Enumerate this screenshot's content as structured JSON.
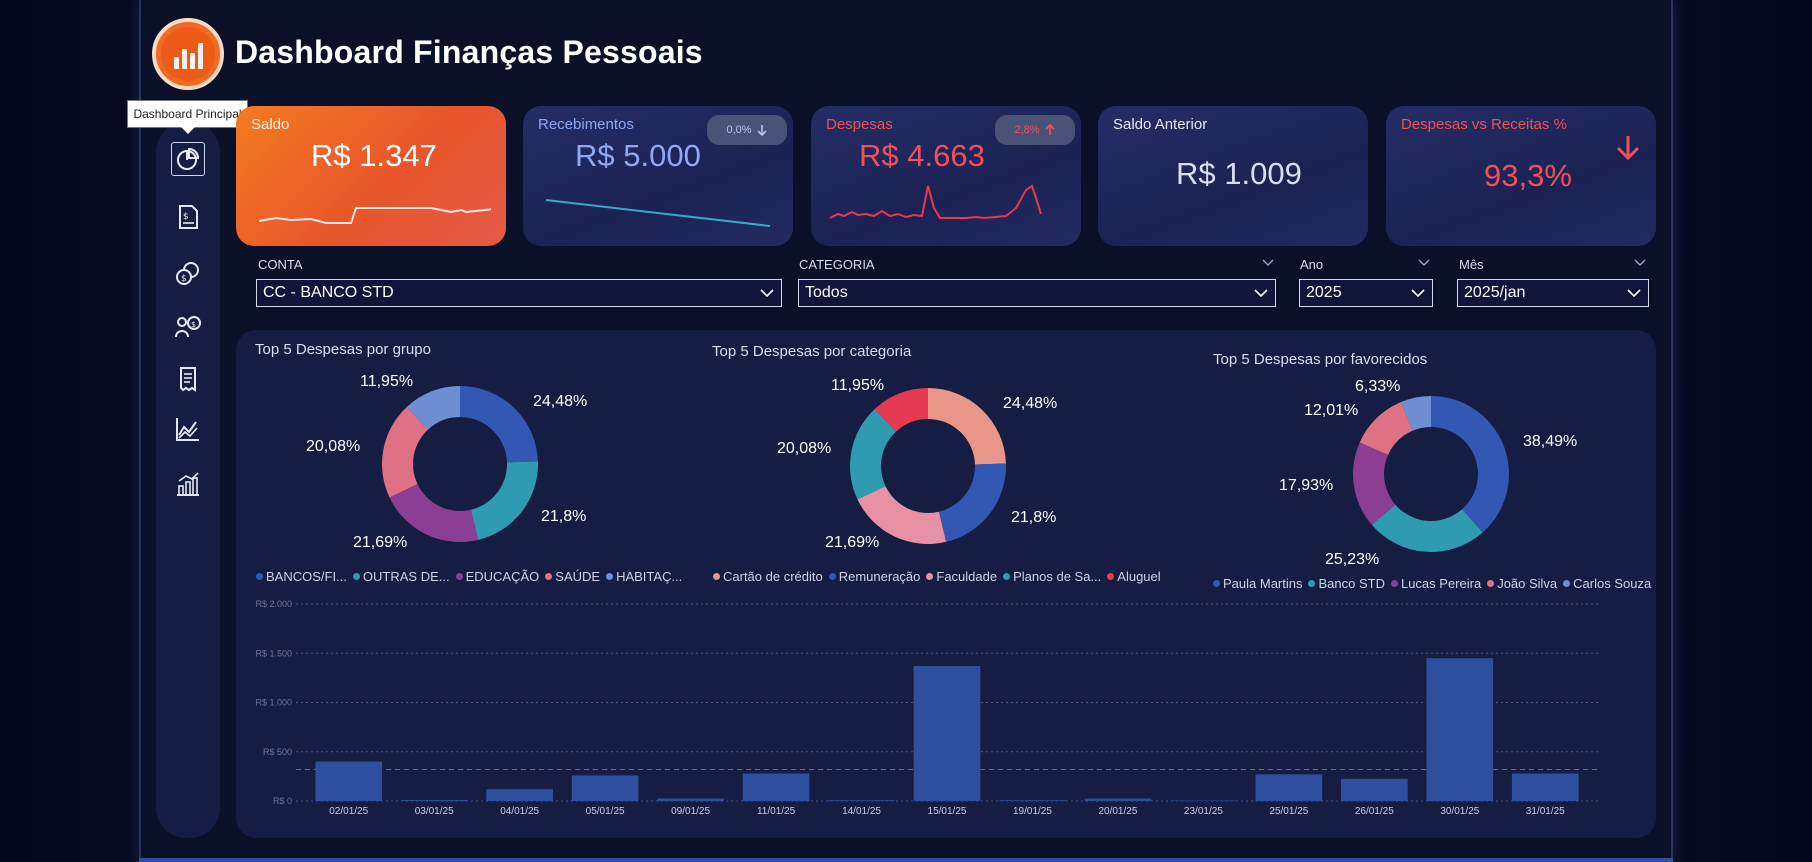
{
  "app": {
    "title": "Dashboard Finanças Pessoais",
    "tooltip": "Dashboard Principal"
  },
  "nav": {
    "items": [
      {
        "icon": "pie-chart-icon",
        "active": true
      },
      {
        "icon": "dollar-document-icon"
      },
      {
        "icon": "coins-icon"
      },
      {
        "icon": "people-money-icon"
      },
      {
        "icon": "receipt-icon"
      },
      {
        "icon": "area-chart-icon"
      },
      {
        "icon": "bar-chart-icon"
      }
    ]
  },
  "cards": {
    "saldo": {
      "label": "Saldo",
      "value": "R$ 1.347"
    },
    "recebimentos": {
      "label": "Recebimentos",
      "value": "R$ 5.000",
      "badge": "0,0%",
      "badge_icon": "arrow-down-icon"
    },
    "despesas": {
      "label": "Despesas",
      "value": "R$ 4.663",
      "badge": "2,8%",
      "badge_icon": "arrow-up-icon"
    },
    "saldo_anterior": {
      "label": "Saldo Anterior",
      "value": "R$ 1.009"
    },
    "desp_receitas": {
      "label": "Despesas vs Receitas %",
      "value": "93,3%",
      "icon": "arrow-down-icon"
    }
  },
  "colors": {
    "accent_orange": "#f06a24",
    "red": "#f0505a",
    "blue_text": "#8fa8f4",
    "blue": "#3258b4",
    "teal": "#2f9bb0",
    "pink": "#e07084",
    "purple": "#8a3f94",
    "light_blue": "#6f8fd4",
    "crimson": "#e63a52",
    "salmon": "#e8958a"
  },
  "filters": {
    "conta": {
      "label": "CONTA",
      "value": "CC - BANCO STD"
    },
    "categoria": {
      "label": "CATEGORIA",
      "value": "Todos"
    },
    "ano": {
      "label": "Ano",
      "value": "2025"
    },
    "mes": {
      "label": "Mês",
      "value": "2025/jan"
    }
  },
  "donuts": [
    {
      "title": "Top 5 Despesas por grupo",
      "legend": [
        "BANCOS/FI...",
        "OUTRAS DE...",
        "EDUCAÇÃO",
        "SAÚDE",
        "HABITAÇ..."
      ]
    },
    {
      "title": "Top 5 Despesas por categoria",
      "legend": [
        "Cartão de crédito",
        "Remuneração",
        "Faculdade",
        "Planos de Sa...",
        "Aluguel"
      ]
    },
    {
      "title": "Top 5 Despesas por favorecidos",
      "legend": [
        "Paula Martins",
        "Banco STD",
        "Lucas Pereira",
        "João Silva",
        "Carlos Souza"
      ]
    }
  ],
  "chart_data": [
    {
      "type": "pie",
      "title": "Top 5 Despesas por grupo",
      "donut": true,
      "categories": [
        "BANCOS/FI...",
        "OUTRAS DE...",
        "EDUCAÇÃO",
        "SAÚDE",
        "HABITAÇ..."
      ],
      "values": [
        24.48,
        21.8,
        21.69,
        20.08,
        11.95
      ],
      "labels": [
        "24,48%",
        "21,8%",
        "21,69%",
        "20,08%",
        "11,95%"
      ],
      "colors": [
        "#3258b4",
        "#2f9bb0",
        "#8a3f94",
        "#e07084",
        "#6f8fd4"
      ]
    },
    {
      "type": "pie",
      "title": "Top 5 Despesas por categoria",
      "donut": true,
      "categories": [
        "Cartão de crédito",
        "Remuneração",
        "Faculdade",
        "Planos de Sa...",
        "Aluguel"
      ],
      "values": [
        24.48,
        21.8,
        21.69,
        20.08,
        11.95
      ],
      "labels": [
        "24,48%",
        "21,8%",
        "21,69%",
        "20,08%",
        "11,95%"
      ],
      "colors": [
        "#e8958a",
        "#3258b4",
        "#e891a4",
        "#2f9bb0",
        "#e63a52"
      ]
    },
    {
      "type": "pie",
      "title": "Top 5 Despesas por favorecidos",
      "donut": true,
      "categories": [
        "Paula Martins",
        "Banco STD",
        "Lucas Pereira",
        "João Silva",
        "Carlos Souza"
      ],
      "values": [
        38.49,
        25.23,
        17.93,
        12.01,
        6.33
      ],
      "labels": [
        "38,49%",
        "25,23%",
        "17,93%",
        "12,01%",
        "6,33%"
      ],
      "colors": [
        "#3258b4",
        "#2f9bb0",
        "#8a3f94",
        "#e07084",
        "#6f8fd4"
      ]
    },
    {
      "type": "bar",
      "title": "",
      "categories": [
        "02/01/25",
        "03/01/25",
        "04/01/25",
        "05/01/25",
        "09/01/25",
        "11/01/25",
        "14/01/25",
        "15/01/25",
        "19/01/25",
        "20/01/25",
        "23/01/25",
        "25/01/25",
        "26/01/25",
        "30/01/25",
        "31/01/25"
      ],
      "values": [
        400,
        10,
        120,
        260,
        25,
        280,
        8,
        1370,
        8,
        25,
        5,
        270,
        225,
        1450,
        280
      ],
      "ylim": [
        0,
        2000
      ],
      "yticks": [
        "R$ 0",
        "R$ 500",
        "R$ 1.000",
        "R$ 1.500",
        "R$ 2.000"
      ],
      "average_line": 320,
      "grid": true,
      "color": "#2f4f9e"
    }
  ]
}
